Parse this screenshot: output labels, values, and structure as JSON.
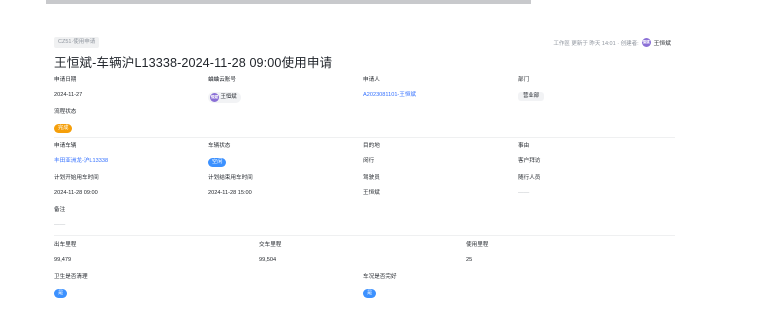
{
  "header": {
    "tag": "CZ51·使用申请",
    "meta_text": "工作區 更新于 昨天 14:01 · 创建者:",
    "owner_avatar": "恒斌",
    "owner_name": "王恒斌"
  },
  "title": "王恒斌-车辆沪L13338-2024-11-28 09:00使用申请",
  "row1": {
    "apply_date": {
      "label": "申请日期",
      "value": "2024-11-27"
    },
    "account": {
      "label": "蛐蛐云账号",
      "avatar": "恒斌",
      "value": "王恒斌"
    },
    "applicant": {
      "label": "申请人",
      "value": "A2023081101-王恒斌"
    },
    "department": {
      "label": "部门",
      "value": "营业部"
    }
  },
  "status": {
    "label": "流程状态",
    "value": "完成",
    "color": "#f59f0a"
  },
  "row2": {
    "vehicle": {
      "label": "申请车辆",
      "value": "丰田亚洲龙-沪L13338"
    },
    "vehicle_status": {
      "label": "车辆状态",
      "value": "空闲",
      "color": "#3c91ff"
    },
    "destination": {
      "label": "目的地",
      "value": "闵行"
    },
    "reason": {
      "label": "事由",
      "value": "客户拜访"
    }
  },
  "row3": {
    "plan_start": {
      "label": "计划开始用车时间",
      "value": "2024-11-28 09:00"
    },
    "plan_end": {
      "label": "计划结束用车时间",
      "value": "2024-11-28 15:00"
    },
    "driver": {
      "label": "驾驶员",
      "value": "王恒斌"
    },
    "companions": {
      "label": "随行人员",
      "value": "——"
    }
  },
  "remark": {
    "label": "备注",
    "value": "——"
  },
  "mileage": {
    "out": {
      "label": "出车里程",
      "value": "99,479"
    },
    "return": {
      "label": "交车里程",
      "value": "99,504"
    },
    "used": {
      "label": "使用里程",
      "value": "25"
    }
  },
  "checks": {
    "hygiene": {
      "label": "卫生是否清理",
      "value": "是",
      "color": "#3c91ff"
    },
    "condition": {
      "label": "车况是否完好",
      "value": "是",
      "color": "#3c91ff"
    }
  }
}
